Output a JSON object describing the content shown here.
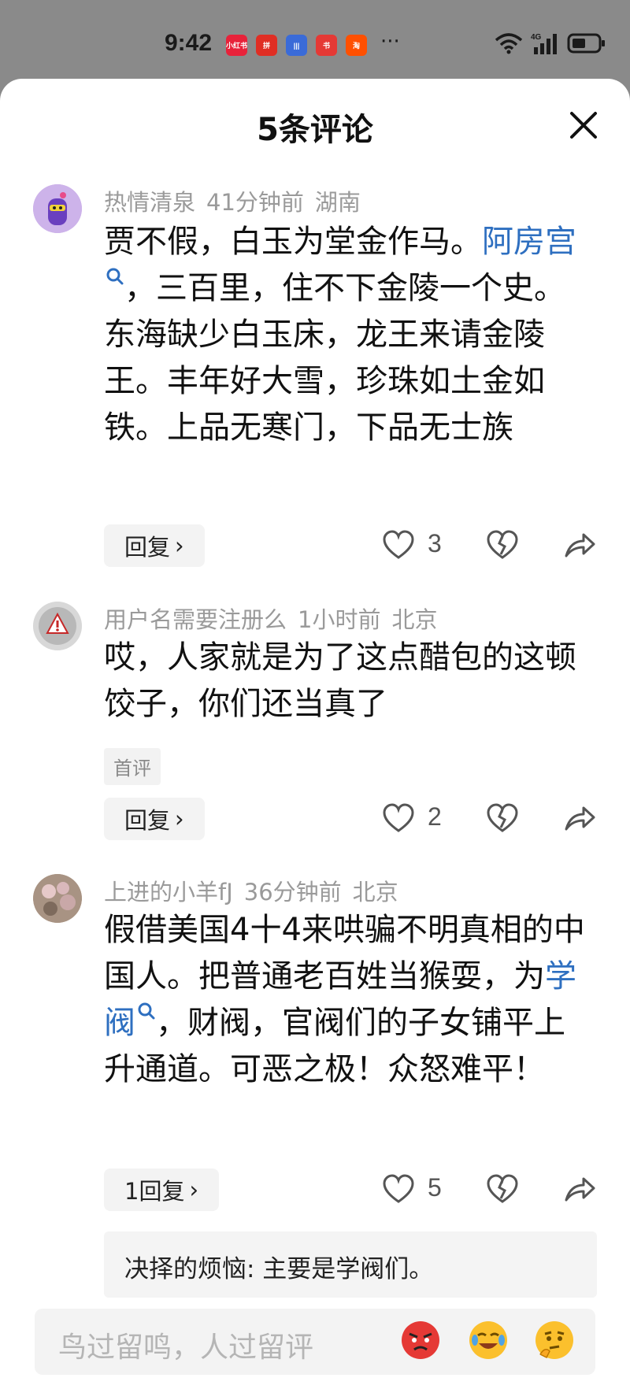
{
  "status_bar": {
    "time": "9:42",
    "apps": [
      {
        "name": "xiaohongshu-icon",
        "label": "小红书",
        "color": "#e8223a"
      },
      {
        "name": "pinduoduo-icon",
        "label": "拼",
        "color": "#e02e24"
      },
      {
        "name": "voice-icon",
        "label": "|||",
        "color": "#3a6bd8"
      },
      {
        "name": "book-icon",
        "label": "书",
        "color": "#e53935"
      },
      {
        "name": "taobao-icon",
        "label": "淘",
        "color": "#ff5000"
      }
    ],
    "more": "···",
    "network": "4G"
  },
  "sheet": {
    "title": "5条评论"
  },
  "comments": [
    {
      "user": "热情清泉",
      "time": "41分钟前",
      "location": "湖南",
      "text_before": "贾不假，白玉为堂金作马。",
      "link": "阿房宫",
      "text_after": "，三百里，住不下金陵一个史。东海缺少白玉床，龙王来请金陵王。丰年好大雪，珍珠如土金如铁。上品无寒门，下品无士族",
      "reply_label": "回复",
      "likes": "3"
    },
    {
      "user": "用户名需要注册么",
      "time": "1小时前",
      "location": "北京",
      "text": "哎，人家就是为了这点醋包的这顿饺子，你们还当真了",
      "tag": "首评",
      "reply_label": "回复",
      "likes": "2"
    },
    {
      "user": "上进的小羊fJ",
      "time": "36分钟前",
      "location": "北京",
      "text_before": "假借美国4十4来哄骗不明真相的中国人。把普通老百姓当猴耍，为",
      "link": "学阀",
      "text_after": "，财阀，官阀们的子女铺平上升通道。可恶之极！众怒难平！",
      "reply_label": "1回复",
      "likes": "5",
      "sub_reply": "决择的烦恼: 主要是学阀们。"
    }
  ],
  "input": {
    "placeholder": "鸟过留鸣，人过留评"
  },
  "colors": {
    "link": "#2e6fc0",
    "meta": "#9a9a9a"
  }
}
